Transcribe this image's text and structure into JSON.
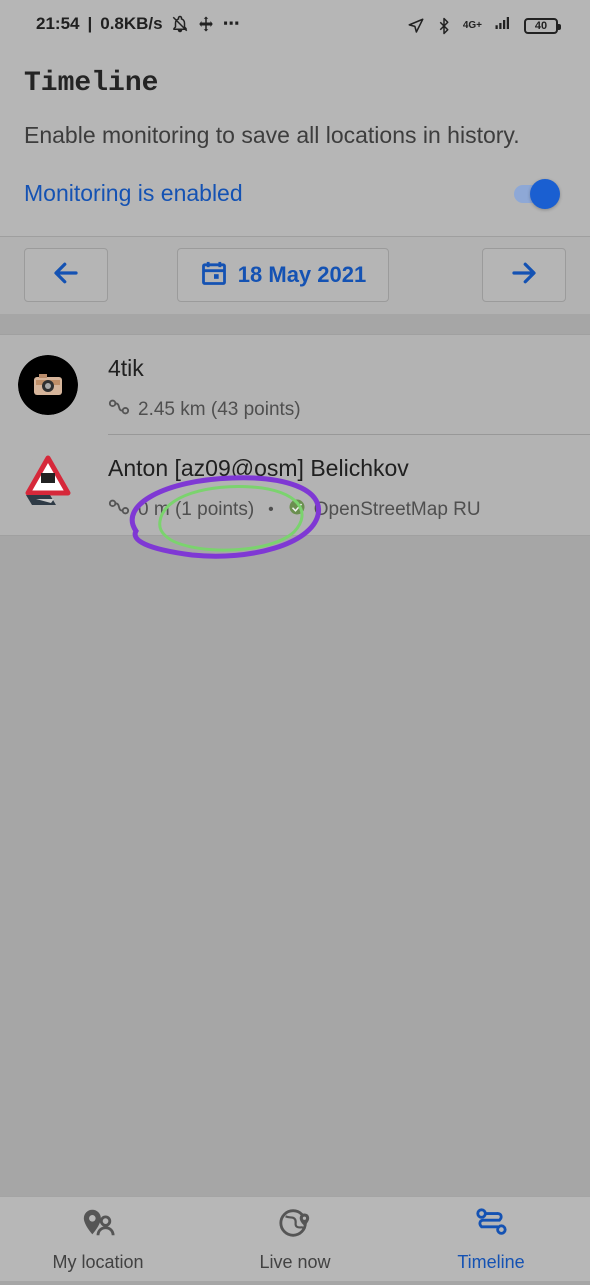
{
  "status_bar": {
    "time": "21:54",
    "speed": "0.8KB/s",
    "more": "⋯",
    "network": "4G+",
    "battery": "40"
  },
  "header": {
    "title": "Timeline",
    "description": "Enable monitoring to save all locations in history.",
    "monitoring_label": "Monitoring is enabled",
    "monitoring_enabled": true
  },
  "date_bar": {
    "date": "18 May 2021",
    "prev_icon": "arrow-left-icon",
    "next_icon": "arrow-right-icon",
    "calendar_icon": "calendar-icon"
  },
  "list": {
    "items": [
      {
        "name": "4tik",
        "distance": "2.45 km (43 points)"
      },
      {
        "name": "Anton [az09@osm] Belichkov",
        "distance": "0 m (1 points)",
        "separator": "•",
        "group": "OpenStreetMap RU"
      }
    ]
  },
  "bottom_nav": {
    "items": [
      {
        "label": "My location",
        "icon": "person-pin-icon"
      },
      {
        "label": "Live now",
        "icon": "globe-pin-icon"
      },
      {
        "label": "Timeline",
        "icon": "timeline-icon",
        "active": true
      }
    ]
  },
  "colors": {
    "accent": "#1452b3",
    "annotation_purple": "#7f38d4",
    "annotation_green": "#7bd36e"
  }
}
